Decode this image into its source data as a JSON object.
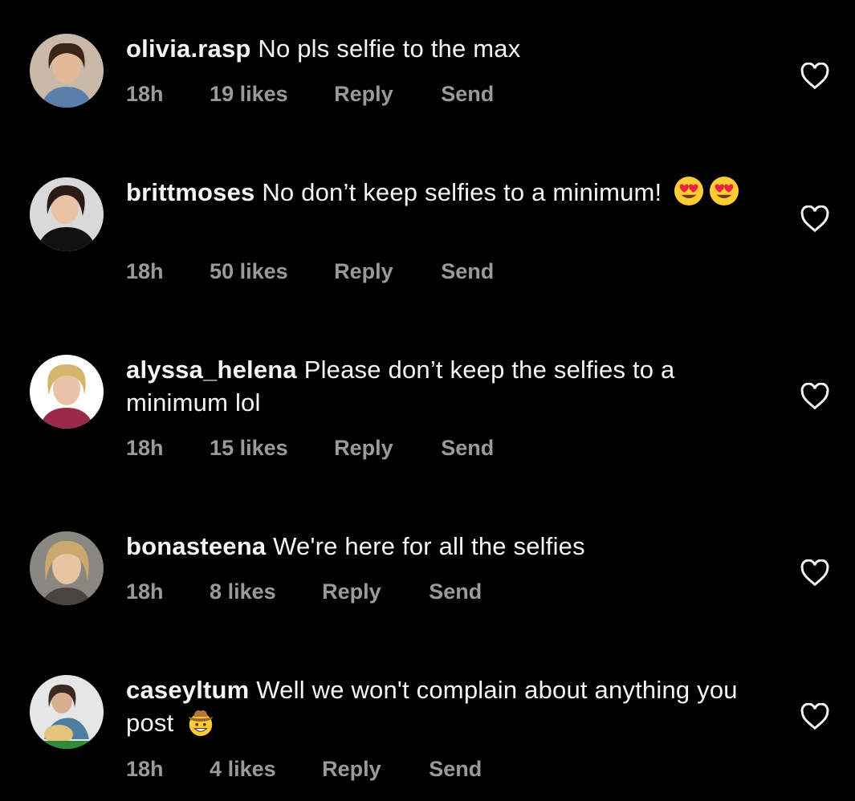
{
  "comments": [
    {
      "username": "olivia.rasp",
      "text": "No pls selfie to the max",
      "time": "18h",
      "likes": "19 likes",
      "reply": "Reply",
      "send": "Send"
    },
    {
      "username": "brittmoses",
      "text": "No don’t keep selfies to a minimum!",
      "time": "18h",
      "likes": "50 likes",
      "reply": "Reply",
      "send": "Send"
    },
    {
      "username": "alyssa_helena",
      "text": "Please don’t keep the selfies to a minimum lol",
      "time": "18h",
      "likes": "15 likes",
      "reply": "Reply",
      "send": "Send"
    },
    {
      "username": "bonasteena",
      "text": "We're here for all the selfies",
      "time": "18h",
      "likes": "8 likes",
      "reply": "Reply",
      "send": "Send"
    },
    {
      "username": "caseyltum",
      "text": "Well we won't complain about anything you post",
      "time": "18h",
      "likes": "4 likes",
      "reply": "Reply",
      "send": "Send"
    }
  ],
  "icons": {
    "like": "heart-outline-icon",
    "emoji_heart_eyes": "heart-eyes-emoji",
    "emoji_cowboy": "cowboy-emoji"
  },
  "colors": {
    "background": "#000000",
    "text": "#f5f5f5",
    "meta": "#9a9a9a"
  }
}
